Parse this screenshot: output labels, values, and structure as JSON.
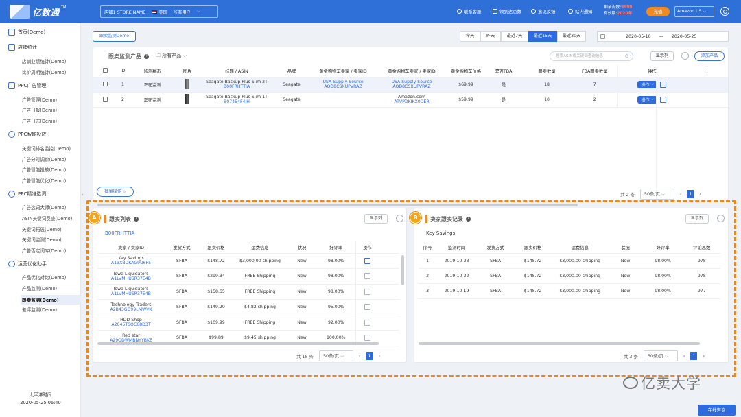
{
  "app": {
    "logo": "亿数通",
    "tm": "TM",
    "store": "店铺1 STORE NAME",
    "country": "美国",
    "users": "所有用户"
  },
  "top": {
    "customer_service": "联系客服",
    "invite": "领到达点数",
    "feedback": "意见反馈",
    "notice": "站内通知",
    "days_left_label": "剩余点数:",
    "days_left": "9999",
    "valid_label": "有效期:",
    "valid": "2020年",
    "upgrade": "充值",
    "account": "Amazon US"
  },
  "sidebar": {
    "home": "首页(Demo)",
    "sections": [
      {
        "title": "店铺统计",
        "items": [
          "店铺业绩统计(Demo)",
          "比价周期统计(Demo)"
        ]
      },
      {
        "title": "PPC广告管理",
        "items": [
          "广告管理(Demo)",
          "广告日报(Demo)",
          "广告日志(Demo)"
        ]
      },
      {
        "title": "PPC智能投放",
        "items": [
          "关键词排名监控(Demo)",
          "广告分时调价(Demo)",
          "广告智能投放(Demo)",
          "广告智能优化(Demo)"
        ]
      },
      {
        "title": "PPC精准选词",
        "items": [
          "广告选词大师(Demo)",
          "ASIN关键词反查(Demo)",
          "关键词拓展(Demo)",
          "关键词监测(Demo)",
          "广告否定词库(Demo)"
        ]
      },
      {
        "title": "运营优化助手",
        "items": [
          "产品优化对比(Demo)",
          "产品监测(Demo)",
          "跟卖监测(Demo)",
          "差评监测(Demo)"
        ]
      }
    ],
    "footer_tz": "太平洋时间",
    "footer_time": "2020-05-25 06:40"
  },
  "toolbar": {
    "tab_label": "跟卖监测Demo",
    "ranges": [
      "今天",
      "昨天",
      "最近7天",
      "最近15天",
      "最近30天"
    ],
    "active_range": "最近15天",
    "date_from": "2020-05-10",
    "date_sep": "—",
    "date_to": "2020-05-25"
  },
  "products": {
    "title": "跟卖监测产品",
    "folder": "所有产品",
    "search_placeholder": "搜索ASIN或关键词查询信息",
    "display_col": "显示列",
    "add_btn": "添加产品",
    "columns": [
      "ID",
      "监测状态",
      "图片",
      "标题 / ASIN",
      "品牌",
      "黄金购物车卖家 / 卖家ID",
      "黄金购物车卖家 / 卖家ID",
      "黄金购物车价格",
      "是否FBA",
      "跟卖数量",
      "FBA跟卖数量",
      "操作"
    ],
    "rows": [
      {
        "id": "1",
        "status": "正在监测",
        "title": "Seagate Backup Plus Slim 2T",
        "asin": "B00FRHTTIA",
        "brand": "Seagate",
        "seller1": "USA Supply Source",
        "seller1_id": "AQD8CSXUPVRAZ",
        "seller2": "USA Supply Source",
        "seller2_id": "AQD8CSXUPVRAZ",
        "price": "$69.99",
        "fba": "是",
        "count": "18",
        "fba_count": "7",
        "op": "操作"
      },
      {
        "id": "2",
        "status": "正在监测",
        "title": "Seagate Backup Plus Slim 1T",
        "asin": "B07454F4JH",
        "brand": "Seagate",
        "seller1": "",
        "seller1_id": "",
        "seller2": "Amazon.com",
        "seller2_id": "ATVPDKIKX0DER",
        "price": "$59.99",
        "fba": "是",
        "count": "10",
        "fba_count": "2",
        "op": "操作"
      }
    ],
    "batch": "批量操作",
    "total": "共 2 条",
    "page_size": "50条/页",
    "page": "1"
  },
  "listing": {
    "badge": "A",
    "title": "跟卖列表",
    "display_col": "显示列",
    "asin": "B00FRHTTIA",
    "columns": [
      "卖家 / 卖家ID",
      "发货方式",
      "跟卖价格",
      "运费信息",
      "状况",
      "好评率",
      "操作"
    ],
    "rows": [
      {
        "name": "Key Savings",
        "id": "A13XBDKAG9U6F5",
        "ship": "SFBA",
        "price": "$148.72",
        "freight": "$3,000.00 shipping",
        "cond": "New",
        "rate": "98.00%"
      },
      {
        "name": "Iowa Liquidators",
        "id": "A1LVMHUSR37E4B",
        "ship": "SFBA",
        "price": "$299.34",
        "freight": "FREE Shipping",
        "cond": "New",
        "rate": "98.00%"
      },
      {
        "name": "Iowa Liquidators",
        "id": "A1LVMHUSR37E4B",
        "ship": "SFBA",
        "price": "$158.65",
        "freight": "FREE Shipping",
        "cond": "New",
        "rate": "98.00%"
      },
      {
        "name": "Technology Traders",
        "id": "A2B43GO99LMWVK",
        "ship": "SFBA",
        "price": "$149.20",
        "freight": "$4.82 shipping",
        "cond": "New",
        "rate": "95.00%"
      },
      {
        "name": "HDD Shop",
        "id": "A2045TSOC68D3T",
        "ship": "SFBA",
        "price": "$109.99",
        "freight": "FREE Shipping",
        "cond": "New",
        "rate": "92.00%"
      },
      {
        "name": "Red star",
        "id": "A29ODWMBNYYBKE",
        "ship": "SFBA",
        "price": "$99.89",
        "freight": "$9.45 shipping",
        "cond": "New",
        "rate": "100.00%"
      }
    ],
    "total": "共 18 条",
    "page_size": "50条/页",
    "page": "1"
  },
  "history": {
    "badge": "B",
    "title": "卖家跟卖记录",
    "display_col": "显示列",
    "seller": "Key Savings",
    "columns": [
      "序号",
      "监测时间",
      "发货方式",
      "跟卖价格",
      "运费信息",
      "状况",
      "好评率",
      "评论总数"
    ],
    "rows": [
      {
        "no": "1",
        "time": "2019-10-23",
        "ship": "SFBA",
        "price": "$148.72",
        "freight": "$3,000.00 shipping",
        "cond": "New",
        "rate": "98.00%",
        "reviews": "978"
      },
      {
        "no": "2",
        "time": "2019-10-22",
        "ship": "SFBA",
        "price": "$148.72",
        "freight": "$3,000.00 shipping",
        "cond": "New",
        "rate": "98.00%",
        "reviews": "978"
      },
      {
        "no": "3",
        "time": "2019-10-19",
        "ship": "SFBA",
        "price": "$148.72",
        "freight": "$3,000.00 shipping",
        "cond": "New",
        "rate": "98.00%",
        "reviews": "977"
      }
    ],
    "total": "共 3 条",
    "page_size": "50条/页",
    "page": "1"
  },
  "watermark": "亿卖大学",
  "chat": "在线咨询"
}
